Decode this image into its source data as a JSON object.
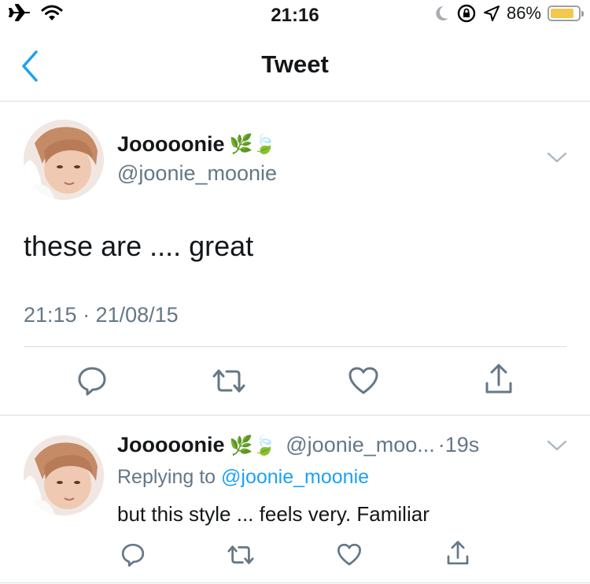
{
  "status_bar": {
    "time": "21:16",
    "battery_percent": "86%",
    "battery_level": 0.86,
    "icons": [
      "airplane-icon",
      "wifi-icon",
      "moon-icon",
      "rotation-lock-icon",
      "location-icon",
      "battery-icon"
    ]
  },
  "nav": {
    "title": "Tweet",
    "back_icon": "chevron-left-icon"
  },
  "main_tweet": {
    "name": "Jooooonie",
    "emojis": "🌿🍃",
    "handle": "@joonie_moonie",
    "text": "these are .... great",
    "timestamp": "21:15 · 21/08/15",
    "actions": [
      "reply-icon",
      "retweet-icon",
      "like-icon",
      "share-icon"
    ]
  },
  "reply_tweet": {
    "name": "Jooooonie",
    "emojis": "🌿🍃",
    "handle": "@joonie_moo...",
    "age": "·19s",
    "replying_prefix": "Replying to ",
    "replying_to": "@joonie_moonie",
    "text": "but this style ... feels very. Familiar",
    "actions": [
      "reply-icon",
      "retweet-icon",
      "like-icon",
      "share-icon"
    ]
  },
  "colors": {
    "accent": "#1da1f2",
    "secondary_text": "#657786",
    "icon_gray": "#657786",
    "battery": "#f2c94c"
  }
}
